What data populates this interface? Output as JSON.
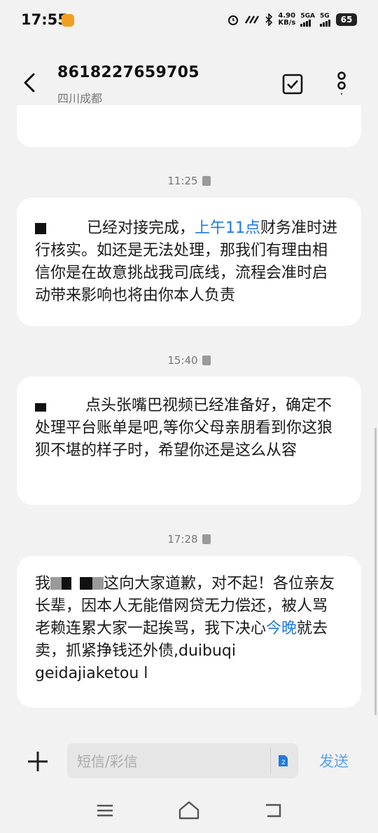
{
  "status_bar": {
    "time": "17:55",
    "net_speed": "4.90",
    "net_unit": "KB/s",
    "sim1_label": "5GA",
    "sim2_label": "5G",
    "battery": "65"
  },
  "header": {
    "contact_number": "8618227659705",
    "contact_location": "四川成都"
  },
  "messages": [
    {
      "timestamp": "11:25",
      "text_before": "已经对接完成，",
      "link": "上午11点",
      "text_after": "财务准时进行核实。如还是无法处理，那我们有理由相信你是在故意挑战我司底线，流程会准时启动带来影响也将由你本人负责"
    },
    {
      "timestamp": "15:40",
      "text": "点头张嘴巴视频已经准备好，确定不处理平台账单是吧,等你父母亲朋看到你这狼狈不堪的样子时，希望你还是这么从容"
    },
    {
      "timestamp": "17:28",
      "text_before": "我",
      "text_mid": "这向大家道歉，对不起！各位亲友长辈，因本人无能借网贷无力偿还，被人骂老赖连累大家一起挨骂，我下决心",
      "link": "今晚",
      "text_after": "就去卖，抓紧挣钱还外债,duibuqi geidajiaketou l"
    }
  ],
  "compose": {
    "placeholder": "短信/彩信",
    "send_label": "发送"
  },
  "colors": {
    "link": "#1f7ae0",
    "send": "#5aa3ee",
    "background": "#f2f2f2",
    "bubble": "#ffffff"
  }
}
